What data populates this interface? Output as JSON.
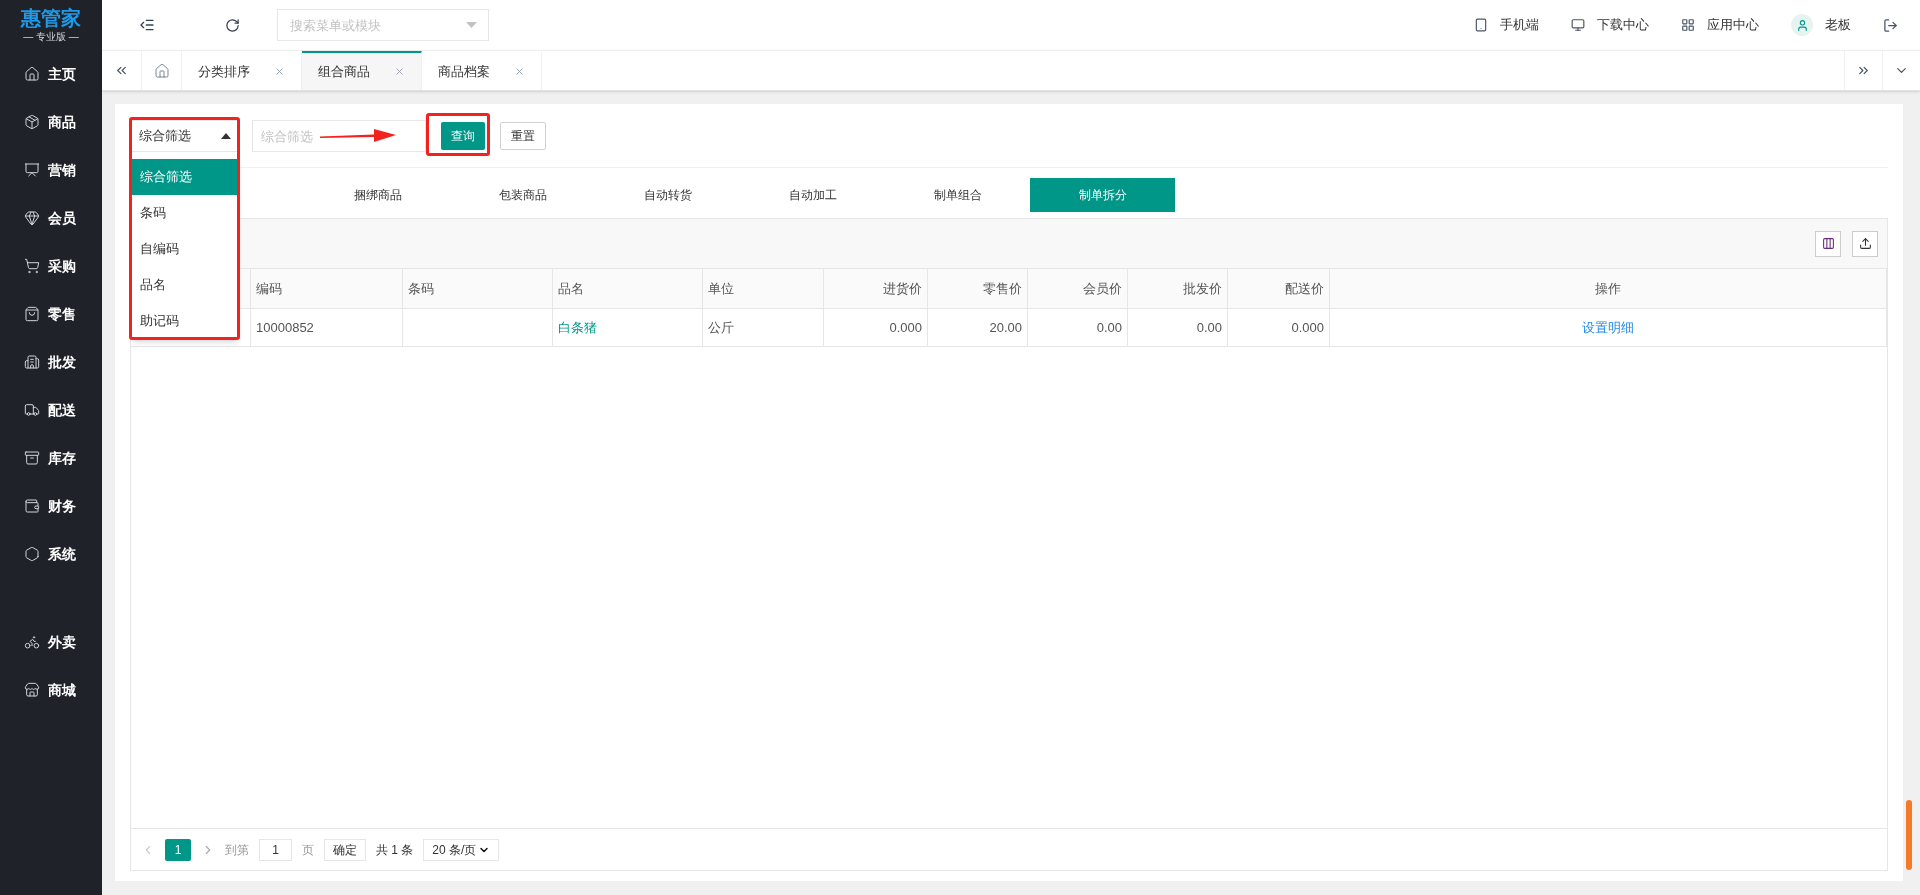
{
  "logo": {
    "name": "惠管家",
    "edition": "— 专业版 —"
  },
  "sidebar": {
    "items": [
      {
        "label": "主页"
      },
      {
        "label": "商品"
      },
      {
        "label": "营销"
      },
      {
        "label": "会员"
      },
      {
        "label": "采购"
      },
      {
        "label": "零售"
      },
      {
        "label": "批发"
      },
      {
        "label": "配送"
      },
      {
        "label": "库存"
      },
      {
        "label": "财务"
      },
      {
        "label": "系统"
      }
    ],
    "extra_items": [
      {
        "label": "外卖"
      },
      {
        "label": "商城"
      }
    ]
  },
  "header": {
    "search": {
      "placeholder": "搜索菜单或模块"
    },
    "links": [
      {
        "label": "手机端"
      },
      {
        "label": "下载中心"
      },
      {
        "label": "应用中心"
      }
    ],
    "user": "老板"
  },
  "tabs": [
    {
      "label": "分类排序",
      "selected": false
    },
    {
      "label": "组合商品",
      "selected": true
    },
    {
      "label": "商品档案",
      "selected": false
    }
  ],
  "filter": {
    "select": {
      "value": "综合筛选",
      "expanded": true,
      "options": [
        {
          "label": "综合筛选",
          "selected": true
        },
        {
          "label": "条码",
          "selected": false
        },
        {
          "label": "自编码",
          "selected": false
        },
        {
          "label": "品名",
          "selected": false
        },
        {
          "label": "助记码",
          "selected": false
        }
      ]
    },
    "input": {
      "placeholder": "综合筛选"
    },
    "buttons": [
      {
        "label": "查询",
        "kind": "primary"
      },
      {
        "label": "重置",
        "kind": "default"
      }
    ]
  },
  "sub_tabs": [
    {
      "label": "捆绑商品",
      "selected": false
    },
    {
      "label": "包装商品",
      "selected": false
    },
    {
      "label": "自动转货",
      "selected": false
    },
    {
      "label": "自动加工",
      "selected": false
    },
    {
      "label": "制单组合",
      "selected": false
    },
    {
      "label": "制单拆分",
      "selected": true
    }
  ],
  "table": {
    "columns": [
      {
        "label": "编码",
        "kind": "text"
      },
      {
        "label": "条码",
        "kind": "text"
      },
      {
        "label": "品名",
        "kind": "link"
      },
      {
        "label": "单位",
        "kind": "text"
      },
      {
        "label": "进货价",
        "kind": "number"
      },
      {
        "label": "零售价",
        "kind": "number"
      },
      {
        "label": "会员价",
        "kind": "number"
      },
      {
        "label": "批发价",
        "kind": "number"
      },
      {
        "label": "配送价",
        "kind": "number"
      },
      {
        "label": "操作",
        "kind": "action"
      }
    ],
    "rows": [
      [
        "10000852",
        null,
        "白条猪",
        "公斤",
        "0.000",
        "20.00",
        "0.00",
        "0.00",
        "0.000",
        "设置明细"
      ]
    ]
  },
  "pagination": {
    "pages": [
      {
        "label": "1",
        "selected": true
      }
    ],
    "goto_label": "到第",
    "goto_value": "1",
    "page_unit": "页",
    "confirm": "确定",
    "total": "共 1 条",
    "page_size": "20 条/页"
  }
}
